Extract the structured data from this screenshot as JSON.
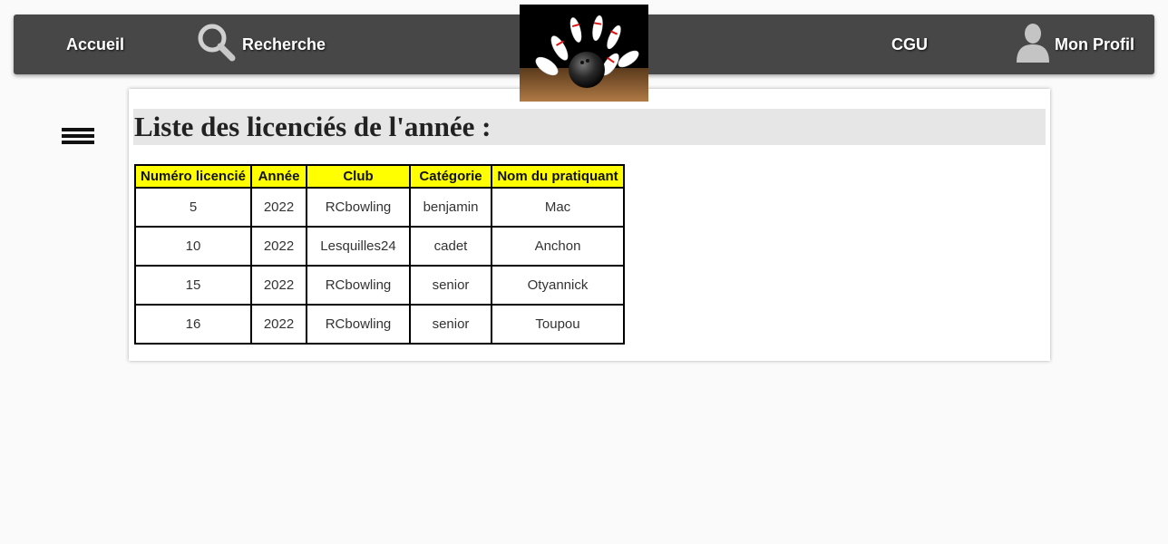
{
  "nav": {
    "accueil": "Accueil",
    "recherche": "Recherche",
    "cgu": "CGU",
    "profil": "Mon Profil"
  },
  "icons": {
    "search": "search-icon",
    "profile": "user-icon",
    "menu": "hamburger-menu-icon",
    "logo": "bowling-logo"
  },
  "page": {
    "title": "Liste des licenciés de l'année :"
  },
  "table": {
    "headers": [
      "Numéro licencié",
      "Année",
      "Club",
      "Catégorie",
      "Nom du pratiquant"
    ],
    "rows": [
      [
        "5",
        "2022",
        "RCbowling",
        "benjamin",
        "Mac"
      ],
      [
        "10",
        "2022",
        "Lesquilles24",
        "cadet",
        "Anchon"
      ],
      [
        "15",
        "2022",
        "RCbowling",
        "senior",
        "Otyannick"
      ],
      [
        "16",
        "2022",
        "RCbowling",
        "senior",
        "Toupou"
      ]
    ]
  },
  "colors": {
    "navbar": "#474747",
    "header_bg": "#ffff00",
    "title_bg": "#e6e6e6"
  }
}
